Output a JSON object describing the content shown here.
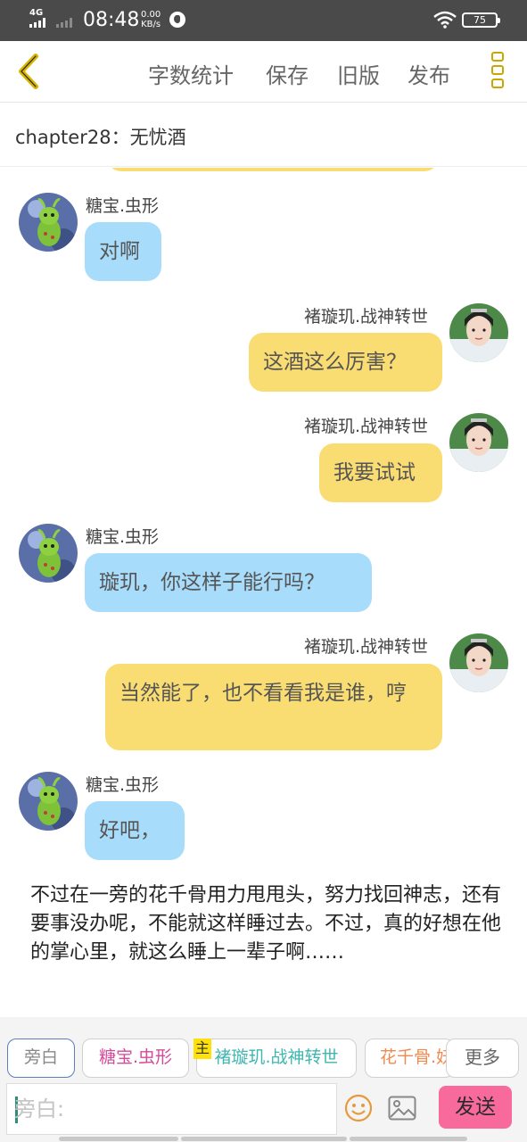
{
  "status_bar": {
    "network": "4G",
    "time": "08:48",
    "speed_value": "0.00",
    "speed_unit": "KB/s",
    "battery": "75"
  },
  "toolbar": {
    "back_icon": "chevron-left-icon",
    "items": [
      "字数统计",
      "保存",
      "旧版",
      "发布"
    ],
    "more_icon": "more-vertical-icon",
    "accent_color": "#c8a800"
  },
  "chapter": {
    "title": "chapter28：无忧酒"
  },
  "messages": [
    {
      "side": "left",
      "name": "糖宝.虫形",
      "text": "对啊"
    },
    {
      "side": "right",
      "name": "褚璇玑.战神转世",
      "text": "这酒这么厉害？"
    },
    {
      "side": "right",
      "name": "褚璇玑.战神转世",
      "text": "我要试试"
    },
    {
      "side": "left",
      "name": "糖宝.虫形",
      "text": "璇玑，你这样子能行吗？"
    },
    {
      "side": "right",
      "name": "褚璇玑.战神转世",
      "text": "当然能了，也不看看我是谁，哼"
    },
    {
      "side": "left",
      "name": "糖宝.虫形",
      "text": "好吧，"
    }
  ],
  "narration": "不过在一旁的花千骨用力甩甩头，努力找回神志，还有要事没办呢，不能就这样睡过去。不过，真的好想在他的掌心里，就这么睡上一辈子啊……",
  "roles": {
    "chips": [
      {
        "label": "旁白",
        "color": "#888888"
      },
      {
        "label": "糖宝.虫形",
        "color": "#d54a9a"
      },
      {
        "label": "褚璇玑.战神转世",
        "color": "#3fb6b0"
      },
      {
        "label": "花千骨.妖",
        "color": "#ef8a50"
      }
    ],
    "main_badge": "主",
    "more_label": "更多"
  },
  "composer": {
    "placeholder": "旁白:",
    "emoji_icon": "smiley-icon",
    "image_icon": "image-icon",
    "send_label": "发送",
    "send_color": "#f86a9c"
  },
  "colors": {
    "left_bubble": "#a8dcfb",
    "right_bubble": "#fadd72"
  }
}
